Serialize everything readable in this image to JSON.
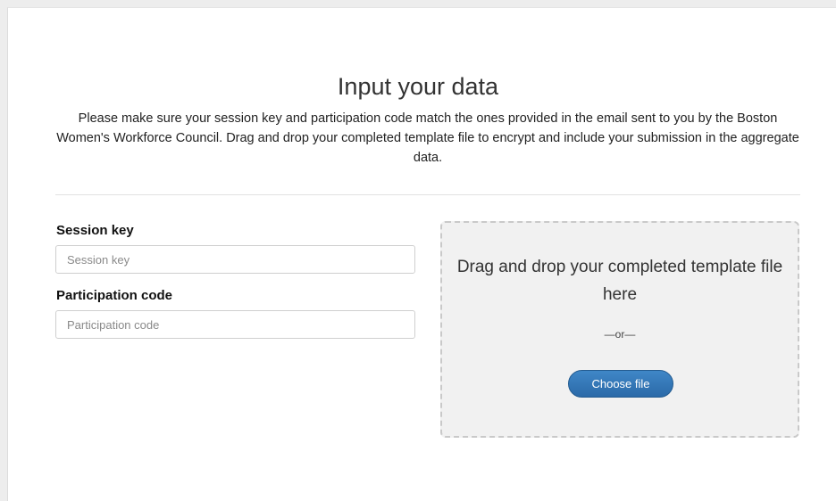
{
  "page": {
    "title": "Input your data",
    "description": "Please make sure your session key and participation code match the ones provided in the email sent to you by the Boston Women's Workforce Council. Drag and drop your completed template file to encrypt and include your submission in the aggregate data."
  },
  "form": {
    "session_key": {
      "label": "Session key",
      "value": "",
      "placeholder": "Session key"
    },
    "participation_code": {
      "label": "Participation code",
      "value": "",
      "placeholder": "Participation code"
    }
  },
  "dropzone": {
    "text": "Drag and drop your completed template file here",
    "separator": "—or—",
    "button_label": "Choose file"
  },
  "colors": {
    "button": "#2f70ad",
    "dropzone_bg": "#f1f1f1",
    "dropzone_border": "#c9c9c9"
  }
}
